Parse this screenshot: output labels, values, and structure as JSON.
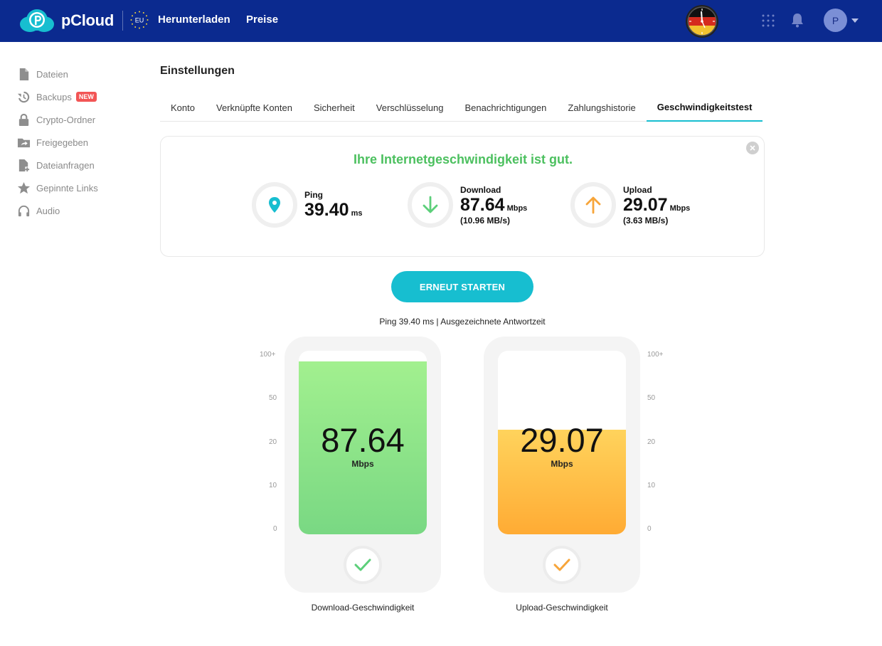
{
  "header": {
    "logo_text": "pCloud",
    "region_badge": "EU",
    "nav": [
      "Herunterladen",
      "Preise"
    ],
    "avatar_initial": "P"
  },
  "sidebar": {
    "items": [
      {
        "label": "Dateien",
        "icon": "file-icon"
      },
      {
        "label": "Backups",
        "icon": "backup-icon",
        "badge": "NEW"
      },
      {
        "label": "Crypto-Ordner",
        "icon": "lock-icon"
      },
      {
        "label": "Freigegeben",
        "icon": "shared-folder-icon"
      },
      {
        "label": "Dateianfragen",
        "icon": "file-request-icon"
      },
      {
        "label": "Gepinnte Links",
        "icon": "star-icon"
      },
      {
        "label": "Audio",
        "icon": "headphones-icon"
      }
    ]
  },
  "page": {
    "title": "Einstellungen",
    "tabs": [
      "Konto",
      "Verknüpfte Konten",
      "Sicherheit",
      "Verschlüsselung",
      "Benachrichtigungen",
      "Zahlungshistorie",
      "Geschwindigkeitstest"
    ],
    "active_tab": "Geschwindigkeitstest"
  },
  "result": {
    "headline": "Ihre Internetgeschwindigkeit ist gut.",
    "ping": {
      "label": "Ping",
      "value": "39.40",
      "unit": "ms"
    },
    "download": {
      "label": "Download",
      "value": "87.64",
      "unit": "Mbps",
      "sub": "(10.96 MB/s)"
    },
    "upload": {
      "label": "Upload",
      "value": "29.07",
      "unit": "Mbps",
      "sub": "(3.63 MB/s)"
    }
  },
  "restart_label": "ERNEUT STARTEN",
  "ping_summary": "Ping 39.40 ms | Ausgezeichnete Antwortzeit",
  "gauges": {
    "scale": [
      "100+",
      "50",
      "20",
      "10",
      "0"
    ],
    "download": {
      "value": "87.64",
      "unit": "Mbps",
      "caption": "Download-Geschwindigkeit",
      "fill_fraction": 0.94
    },
    "upload": {
      "value": "29.07",
      "unit": "Mbps",
      "caption": "Upload-Geschwindigkeit",
      "fill_fraction": 0.57
    }
  },
  "colors": {
    "topbar": "#0b2a8f",
    "accent": "#17bed0",
    "good": "#4cc05f",
    "download_arrow": "#5ccf7a",
    "upload_arrow": "#f7a53a"
  }
}
